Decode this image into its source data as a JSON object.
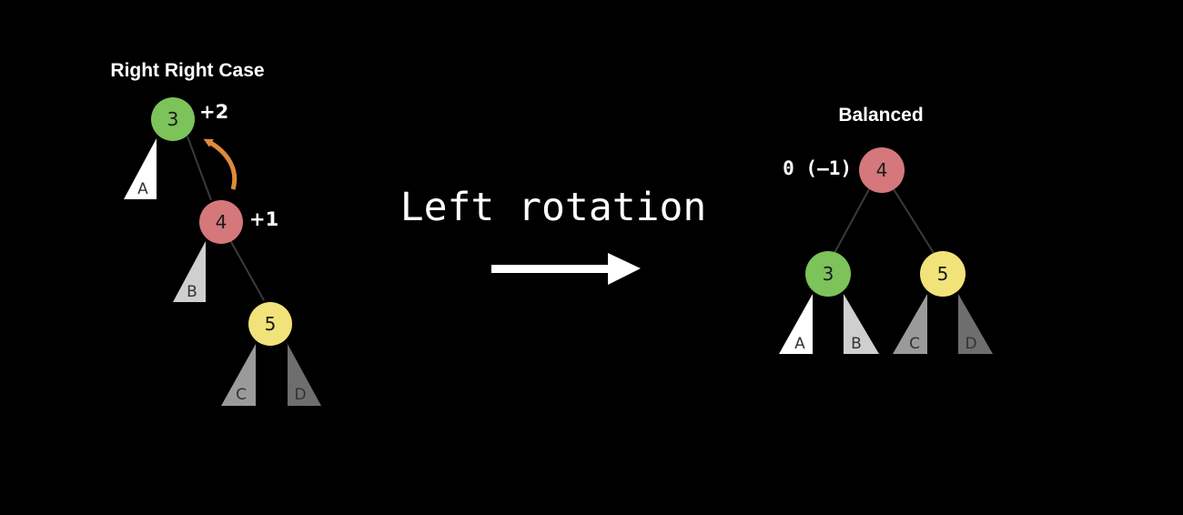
{
  "left_tree": {
    "title": "Right Right Case",
    "nodes": [
      {
        "key": "3",
        "balance": "+2",
        "color": "#7cc35a"
      },
      {
        "key": "4",
        "balance": "+1",
        "color": "#d4787c"
      },
      {
        "key": "5",
        "balance": "",
        "color": "#f2e27a"
      }
    ],
    "subtrees": [
      "A",
      "B",
      "C",
      "D"
    ]
  },
  "operation": {
    "label": "Left rotation"
  },
  "right_tree": {
    "title": "Balanced",
    "nodes": [
      {
        "key": "4",
        "balance": "0 (–1)",
        "color": "#d4787c"
      },
      {
        "key": "3",
        "balance": "",
        "color": "#7cc35a"
      },
      {
        "key": "5",
        "balance": "",
        "color": "#f2e27a"
      }
    ],
    "subtrees": [
      "A",
      "B",
      "C",
      "D"
    ]
  },
  "colors": {
    "background": "#000000",
    "rotation_arrow": "#e08a3c",
    "subtree_white": "#ffffff",
    "subtree_light": "#cfcfcf",
    "subtree_mid": "#9a9a9a",
    "subtree_dark": "#6e6e6e"
  }
}
